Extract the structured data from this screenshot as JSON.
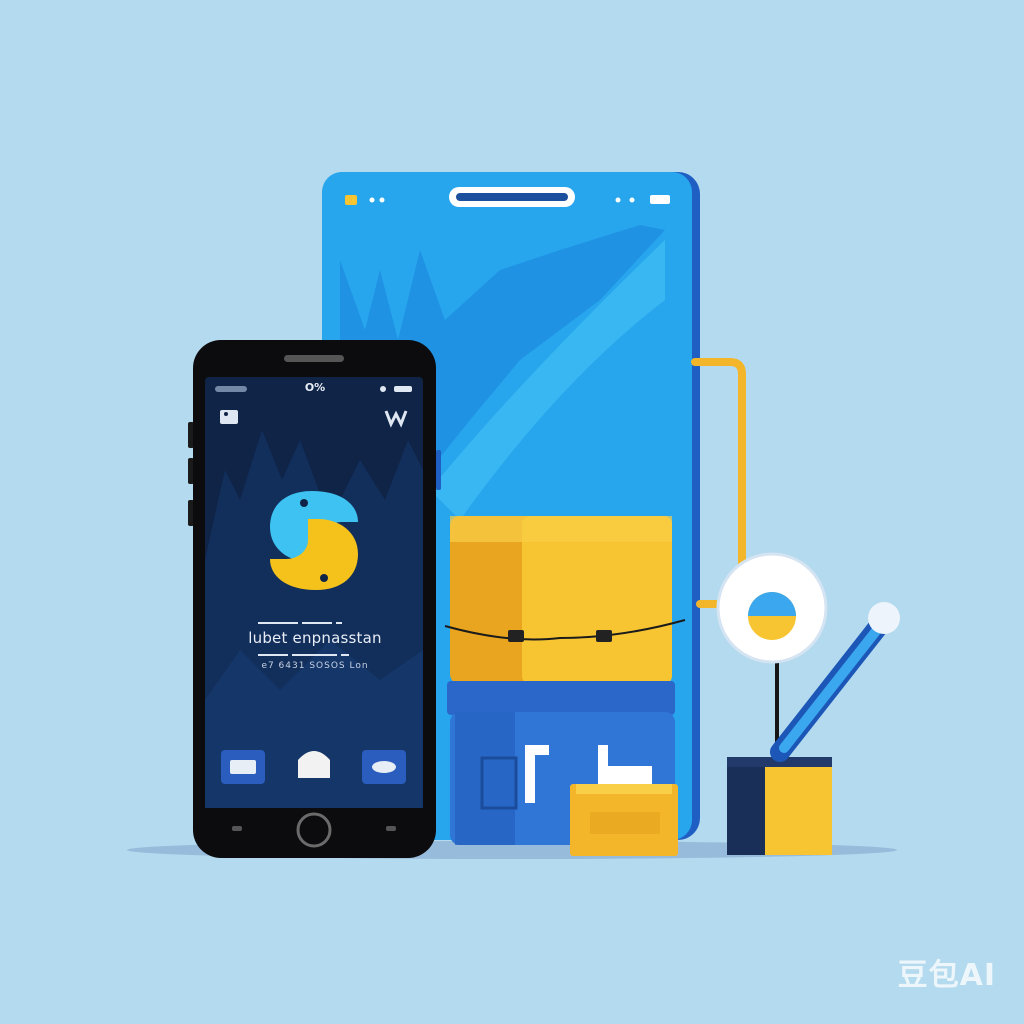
{
  "phone": {
    "status_time": "O%",
    "app_title": "lubet enpnasstan",
    "app_subtitle": "e7 6431 SOSOS Lon"
  },
  "watermark": "豆包AI",
  "icons": {
    "app_logo": "python-logo-icon",
    "nav_left": "nav-left-icon",
    "nav_center": "home-icon",
    "nav_right": "nav-right-icon"
  },
  "colors": {
    "background": "#b3daee",
    "phone_screen": "#0f2447",
    "tablet_blue": "#28a9ee",
    "box_yellow": "#f3b62a",
    "box_blue": "#2d6fd0",
    "accent_yellow": "#f7c531"
  }
}
